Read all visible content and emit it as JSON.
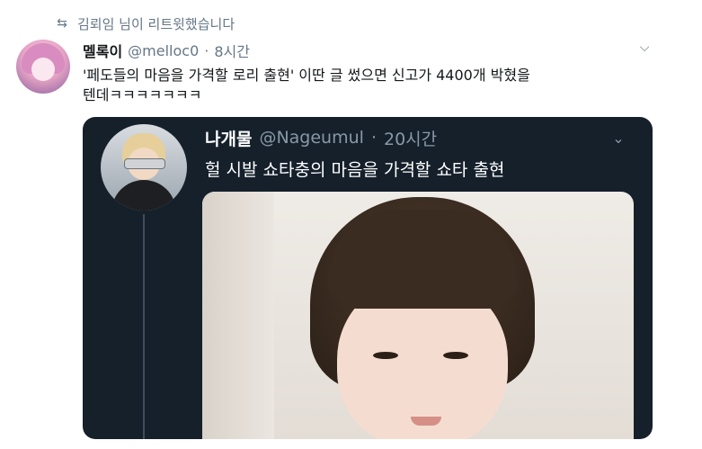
{
  "retweet": {
    "icon": "retweet-icon",
    "label": "김뢰임 님이 리트윗했습니다"
  },
  "tweet": {
    "display_name": "멜록이",
    "handle": "@melloc0",
    "separator": "·",
    "time": "8시간",
    "text": "'페도들의 마음을 가격할 로리 출현' 이딴 글 썼으면 신고가 4400개 박혔을\n텐데ㅋㅋㅋㅋㅋㅋㅋ",
    "menu_icon": "chevron-down-icon"
  },
  "quoted": {
    "display_name": "나개물",
    "handle": "@Nageumul",
    "separator": "·",
    "time": "20시간",
    "text": "헐 시발 쇼타충의 마음을 가격할 쇼타 출현",
    "menu_icon": "chevron-down-icon"
  },
  "colors": {
    "background": "#ffffff",
    "card_background": "#15202b",
    "muted_text": "#657786",
    "dark_muted_text": "#8899a6"
  }
}
